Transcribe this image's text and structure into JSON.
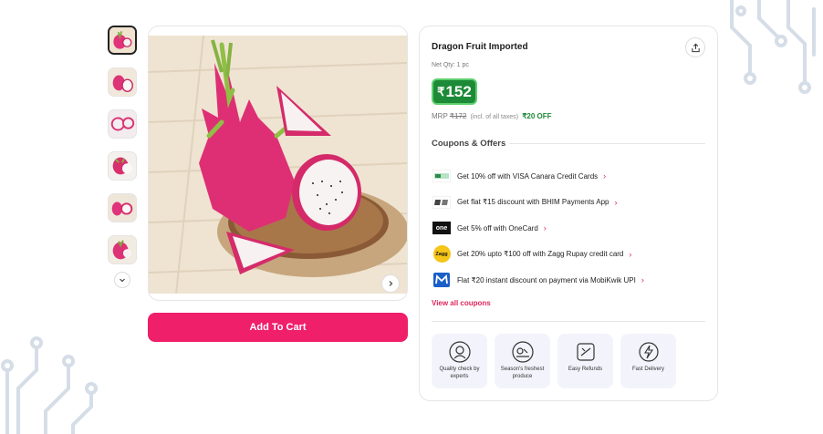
{
  "product": {
    "title": "Dragon Fruit Imported",
    "net_qty": "Net Qty: 1 pc",
    "price_symbol": "₹",
    "price": "152",
    "mrp_label": "MRP",
    "mrp_value": "₹172",
    "tax_note": "(incl. of all taxes)",
    "discount": "₹20 OFF"
  },
  "thumbnails": [
    "dragon-fruit-thumb-1",
    "dragon-fruit-thumb-2",
    "dragon-fruit-thumb-3",
    "dragon-fruit-thumb-4",
    "dragon-fruit-thumb-5",
    "dragon-fruit-thumb-6"
  ],
  "actions": {
    "add_to_cart": "Add To Cart"
  },
  "coupons": {
    "title": "Coupons & Offers",
    "view_all": "View all coupons",
    "items": [
      {
        "logo": "visa-canara-logo",
        "text": "Get 10% off with VISA Canara Credit Cards"
      },
      {
        "logo": "bhim-logo",
        "text": "Get flat ₹15 discount with BHIM Payments App"
      },
      {
        "logo": "onecard-logo",
        "text": "Get 5% off with OneCard",
        "logo_text": "one"
      },
      {
        "logo": "zagg-logo",
        "text": "Get 20% upto ₹100 off with Zagg Rupay credit card",
        "logo_text": "Zagg"
      },
      {
        "logo": "mobikwik-logo",
        "text": "Flat ₹20 instant discount on payment via MobiKwik UPI"
      }
    ]
  },
  "features": [
    {
      "icon": "quality-check-icon",
      "label": "Quality check by experts"
    },
    {
      "icon": "seasons-freshest-icon",
      "label": "Season's freshest produce"
    },
    {
      "icon": "easy-refunds-icon",
      "label": "Easy Refunds"
    },
    {
      "icon": "fast-delivery-icon",
      "label": "Fast Delivery"
    }
  ],
  "colors": {
    "brand_pink": "#ef1f6a",
    "price_green": "#1c8a36",
    "link_pink": "#e0255b",
    "feature_bg": "#f3f4fb"
  }
}
